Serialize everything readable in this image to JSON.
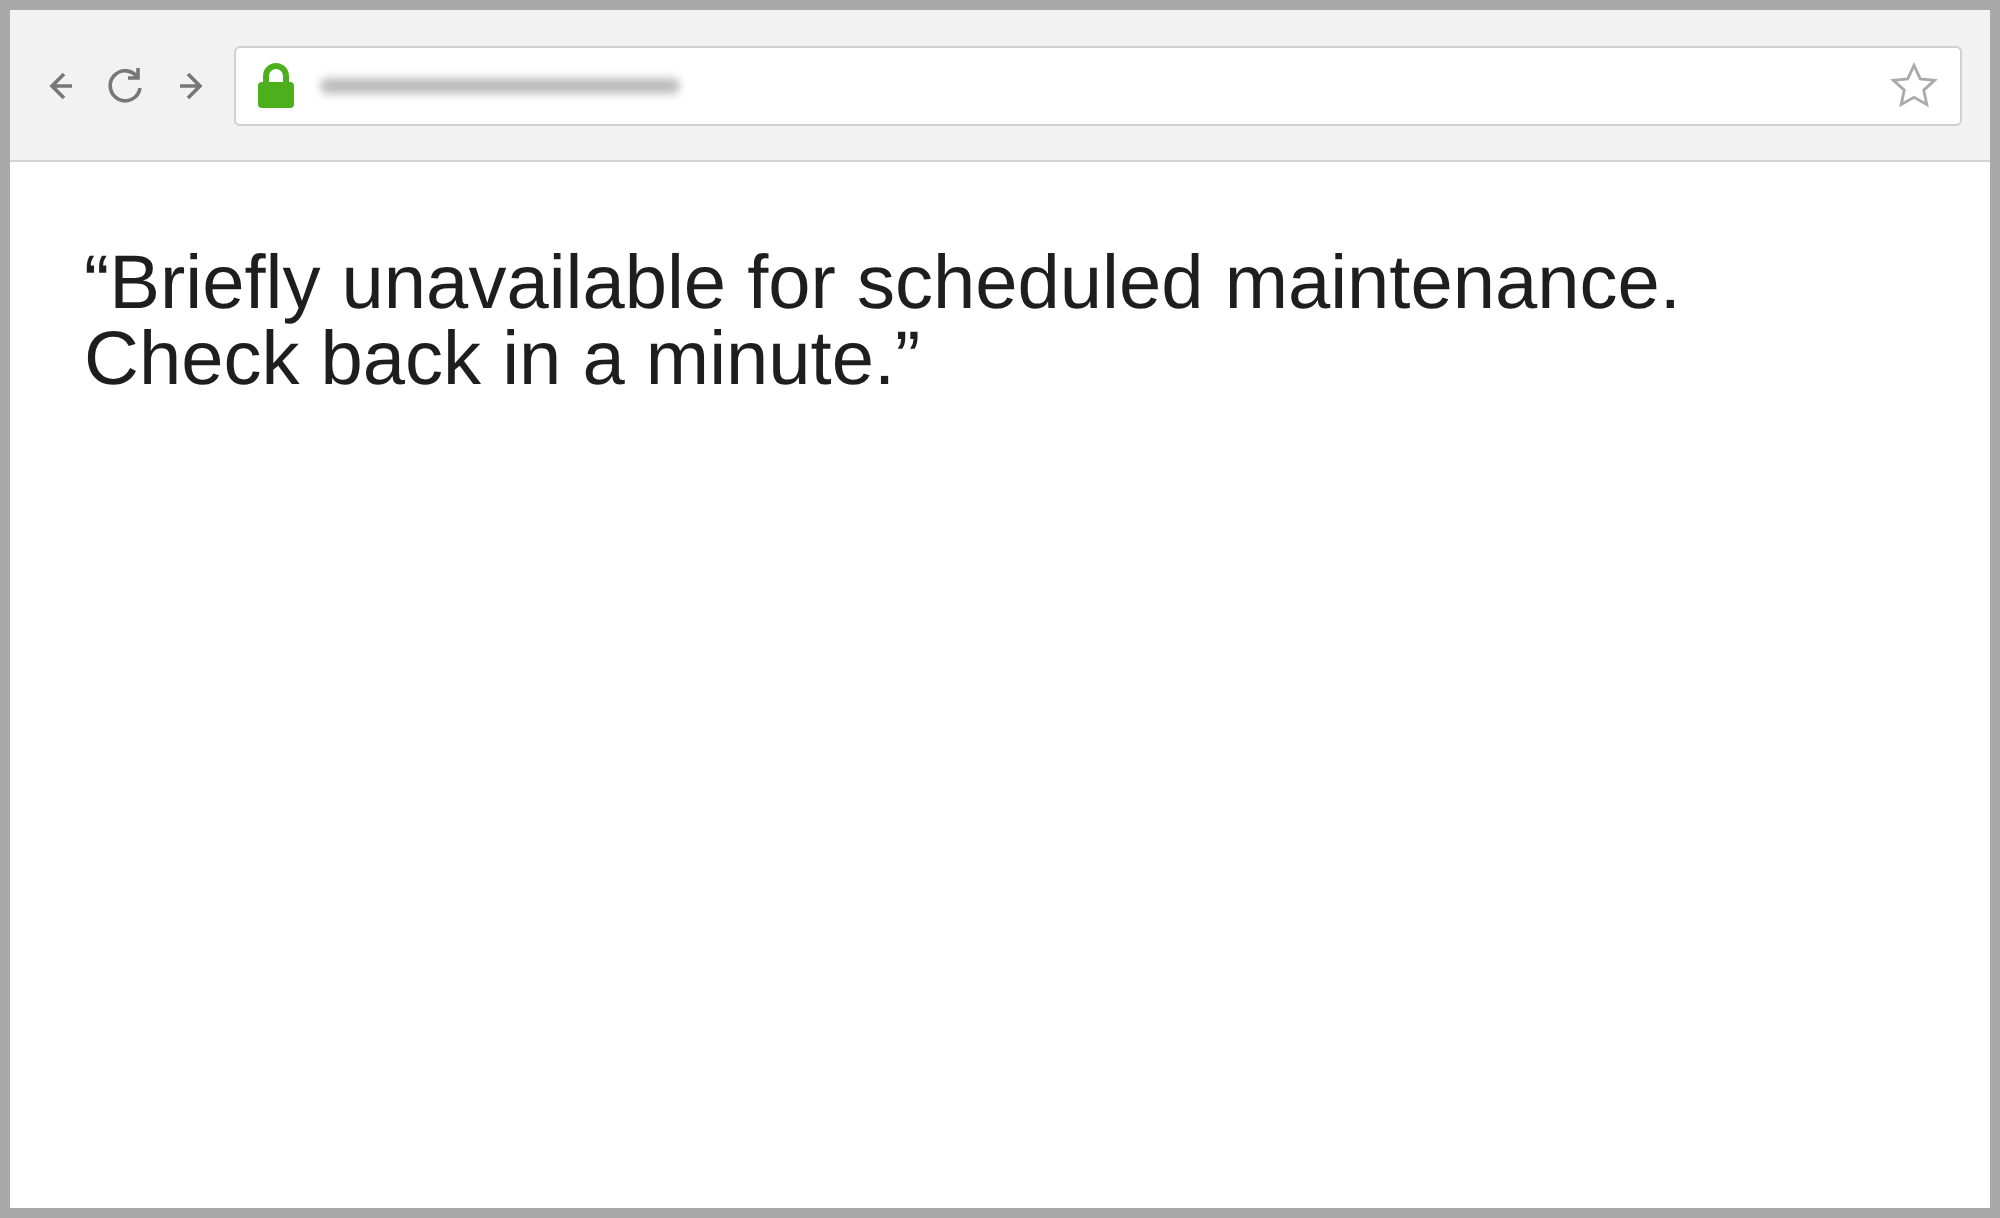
{
  "browser": {
    "secure": true,
    "bookmarked": false
  },
  "page": {
    "message": "“Briefly unavailable for scheduled maintenance.\nCheck back in a minute.”"
  }
}
